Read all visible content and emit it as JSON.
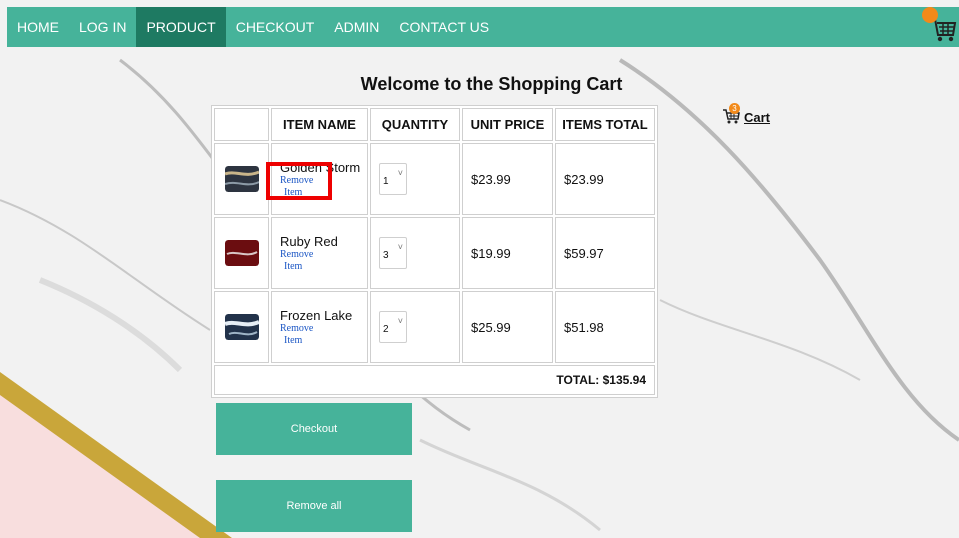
{
  "nav": {
    "items": [
      "HOME",
      "LOG IN",
      "PRODUCT",
      "CHECKOUT",
      "ADMIN",
      "CONTACT US"
    ],
    "active_index": 2,
    "cart_icon": "cart-icon"
  },
  "page": {
    "title": "Welcome to the Shopping Cart"
  },
  "cart_link": {
    "label": "Cart",
    "count": "3"
  },
  "table": {
    "headers": [
      "",
      "ITEM NAME",
      "QUANTITY",
      "UNIT PRICE",
      "ITEMS TOTAL"
    ],
    "rows": [
      {
        "name": "Golden Storm",
        "remove_1": "Remove",
        "remove_2": "Item",
        "qty": "1",
        "unit_price": "$23.99",
        "items_total": "$23.99"
      },
      {
        "name": "Ruby Red",
        "remove_1": "Remove",
        "remove_2": "Item",
        "qty": "3",
        "unit_price": "$19.99",
        "items_total": "$59.97"
      },
      {
        "name": "Frozen Lake",
        "remove_1": "Remove",
        "remove_2": "Item",
        "qty": "2",
        "unit_price": "$25.99",
        "items_total": "$51.98"
      }
    ],
    "total": "TOTAL: $135.94"
  },
  "buttons": {
    "checkout": "Checkout",
    "remove_all": "Remove all"
  },
  "colors": {
    "nav": "#46b39a",
    "nav_active": "#1e7a62",
    "button": "#46b39a",
    "highlight": "#ee0000",
    "badge": "#f28a1a"
  }
}
